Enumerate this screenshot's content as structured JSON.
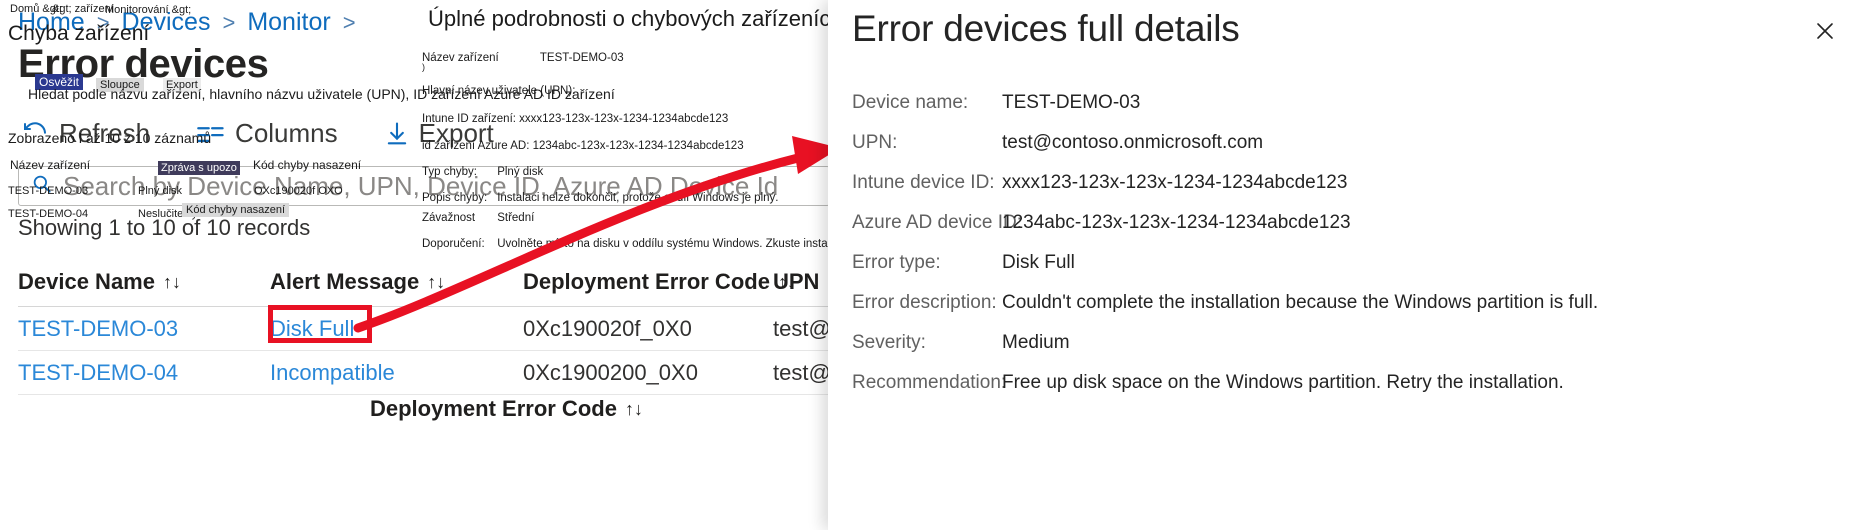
{
  "base": {
    "breadcrumb": {
      "items": [
        "Home",
        "Devices",
        "Monitor"
      ],
      "separator": ">",
      "trailing_separator": ">"
    },
    "page_title": "Error devices",
    "command_bar": [
      {
        "label": "Refresh",
        "icon": "refresh-icon"
      },
      {
        "label": "Columns",
        "icon": "columns-icon"
      },
      {
        "label": "Export",
        "icon": "download-icon"
      }
    ],
    "search": {
      "placeholder": "Search by Device Name, UPN, Device ID, Azure AD Device Id",
      "icon": "search-icon",
      "value": ""
    },
    "records_line": "Showing 1 to 10 of 10 records",
    "table": {
      "sort_glyph": "↑↓",
      "columns": [
        "Device Name",
        "Alert Message",
        "Deployment Error Code",
        "UPN"
      ],
      "rows": [
        {
          "device_name": "TEST-DEMO-03",
          "alert_message": "Disk Full",
          "error_code": "0Xc190020f_0X0",
          "upn": "test@c"
        },
        {
          "device_name": "TEST-DEMO-04",
          "alert_message": "Incompatible",
          "error_code": "0Xc1900200_0X0",
          "upn": "test@c"
        }
      ],
      "footer_column": "Deployment Error Code"
    }
  },
  "czech_overlay": {
    "breadcrumb": [
      "Domů &gt;",
      "&gt; zařízení",
      "Monitorování &gt;"
    ],
    "subtitle": "Chyba zařízení",
    "command_bar": [
      "Osvěžit",
      "Sloupce",
      "Export"
    ],
    "search_hint": "Hledat podle názvu zařízení, hlavního názvu uživatele (UPN), ID zařízení Azure AD ID zařízení",
    "records_line": "Zobrazeno l až 10 z 10 záznamů",
    "table_headers": [
      "Název zařízení",
      "Zpráva s upozo",
      "Kód chyby nasazení"
    ],
    "table_rows": [
      {
        "device": "TEST-DEMO-03",
        "alert": "Plný disk",
        "code": "OXc190020f OXO"
      },
      {
        "device": "TEST-DEMO-04",
        "alert": "Neslučitelný",
        "code": ""
      }
    ],
    "footer_chip": "Kód chyby nasazení",
    "card": {
      "title": "Úplné podrobnosti o chybových zařízeních",
      "rows": [
        {
          "label": "Název zařízení",
          "value": "TEST-DEMO-03"
        },
        {
          "label": "Hlavní název uživatele (UPN):",
          "value": ""
        },
        {
          "label": "Intune ID zařízení: xxxx123-123x-123x-1234-1234abcde123",
          "value": ""
        },
        {
          "label": "id zařízení Azure AD: 1234abc-123x-123x-1234-1234abcde123",
          "value": ""
        },
        {
          "label": "Typ chyby:",
          "value": "Plný disk"
        },
        {
          "label": "Popis chyby:",
          "value": "Instalaci nelze dokončit, protože oddíl Windows je plný."
        },
        {
          "label": "Závažnost",
          "value": "Střední"
        },
        {
          "label": "Doporučení:",
          "value": "Uvolněte místo na disku v oddílu systému Windows. Zkuste instalaci zopakovat."
        }
      ]
    }
  },
  "flyout": {
    "title": "Error devices full details",
    "close_icon": "close-icon",
    "rows": [
      {
        "label": "Device name:",
        "value": "TEST-DEMO-03"
      },
      {
        "label": "UPN:",
        "value": "test@contoso.onmicrosoft.com"
      },
      {
        "label": "Intune device ID:",
        "value": "xxxx123-123x-123x-1234-1234abcde123"
      },
      {
        "label": "Azure AD device ID:",
        "value": "1234abc-123x-123x-1234-1234abcde123"
      },
      {
        "label": "Error type:",
        "value": "Disk Full"
      },
      {
        "label": "Error description:",
        "value": "Couldn't complete the installation because the Windows partition is full."
      },
      {
        "label": "Severity:",
        "value": "Medium"
      },
      {
        "label": "Recommendation:",
        "value": "Free up disk space on the Windows partition. Retry the installation."
      }
    ]
  },
  "colors": {
    "accent_link": "#2b88d8",
    "breadcrumb_link": "#0f6cbd",
    "annotation_red": "#e81123",
    "panel_bg": "#ffffff"
  }
}
